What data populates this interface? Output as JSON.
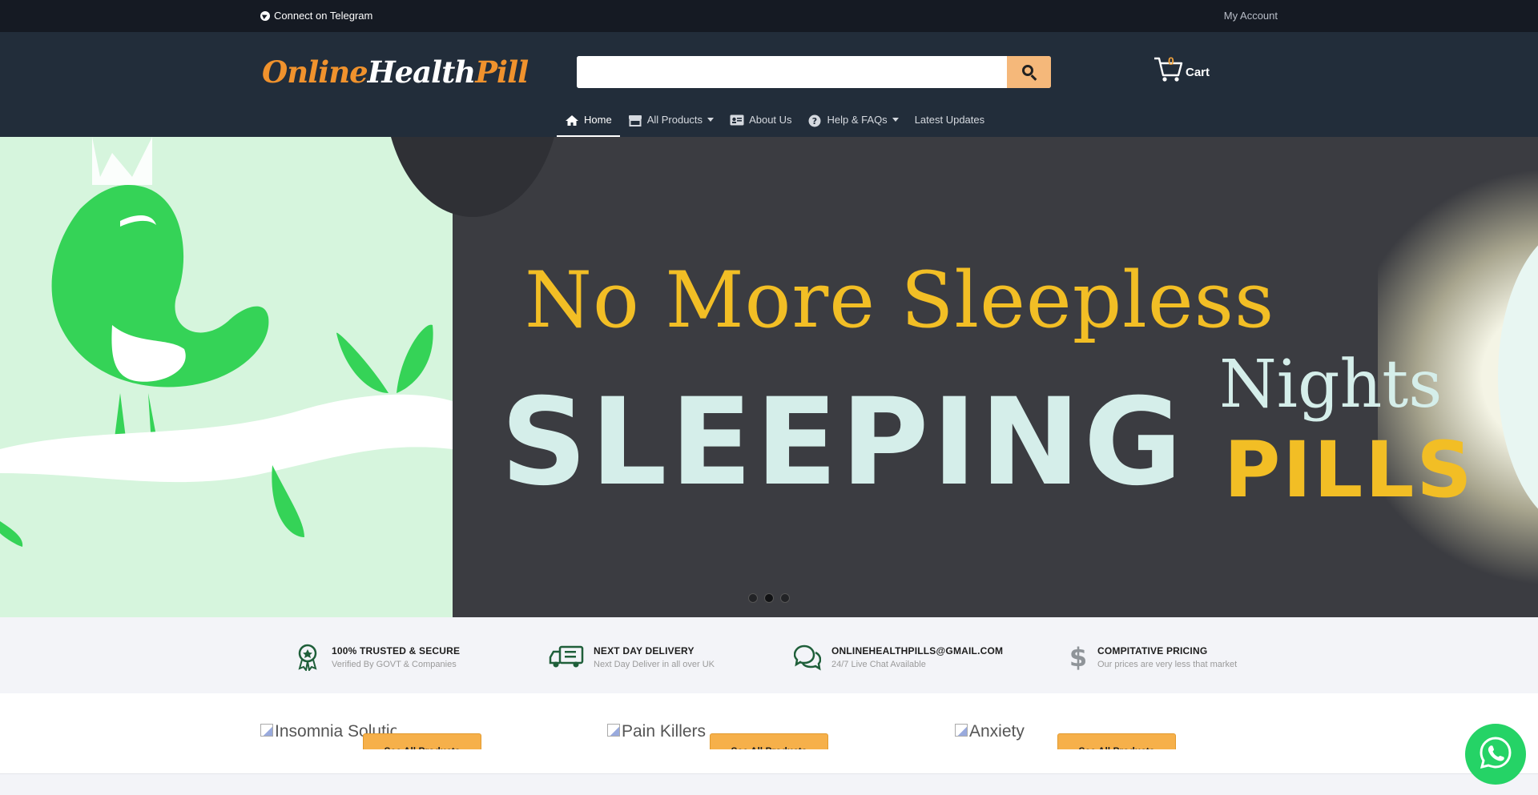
{
  "topbar": {
    "telegram_label": "Connect on Telegram",
    "account_label": "My Account"
  },
  "header": {
    "logo_part1": "Online",
    "logo_part2": "Health",
    "logo_part3": "Pill",
    "search": {
      "value": "",
      "placeholder": ""
    },
    "cart": {
      "count": "0",
      "label": "Cart"
    }
  },
  "nav": {
    "items": [
      {
        "label": "Home",
        "icon": "home-icon",
        "active": true
      },
      {
        "label": "All Products",
        "icon": "store-icon",
        "dropdown": true
      },
      {
        "label": "About Us",
        "icon": "id-card-icon"
      },
      {
        "label": "Help & FAQs",
        "icon": "question-circle-icon",
        "dropdown": true
      },
      {
        "label": "Latest Updates"
      }
    ]
  },
  "hero": {
    "line1": "No More Sleepless",
    "line2": "SLEEPING",
    "line3": "Nights",
    "line4": "PILLS",
    "slide_count": 3,
    "active_slide": 2
  },
  "features": [
    {
      "title": "100% TRUSTED & SECURE",
      "subtitle": "Verified By GOVT & Companies",
      "icon": "award-icon"
    },
    {
      "title": "NEXT DAY DELIVERY",
      "subtitle": "Next Day Deliver in all over UK",
      "icon": "truck-icon"
    },
    {
      "title": "ONLINEHEALTHPILLS@GMAIL.COM",
      "subtitle": "24/7 Live Chat Available",
      "icon": "chat-icon"
    },
    {
      "title": "COMPITATIVE PRICING",
      "subtitle": "Our prices are very less that market",
      "icon": "dollar-icon"
    }
  ],
  "categories": [
    {
      "alt": "Insomnia Solution",
      "button": "See All Products"
    },
    {
      "alt": "Pain Killers",
      "button": "See All Products"
    },
    {
      "alt": "Anxiety",
      "button": "See All Products"
    }
  ],
  "colors": {
    "topbar_bg": "#151a23",
    "header_bg": "#222d3a",
    "accent_orange": "#f0922d",
    "hero_yellow": "#f2be25",
    "whatsapp_green": "#25d366"
  }
}
